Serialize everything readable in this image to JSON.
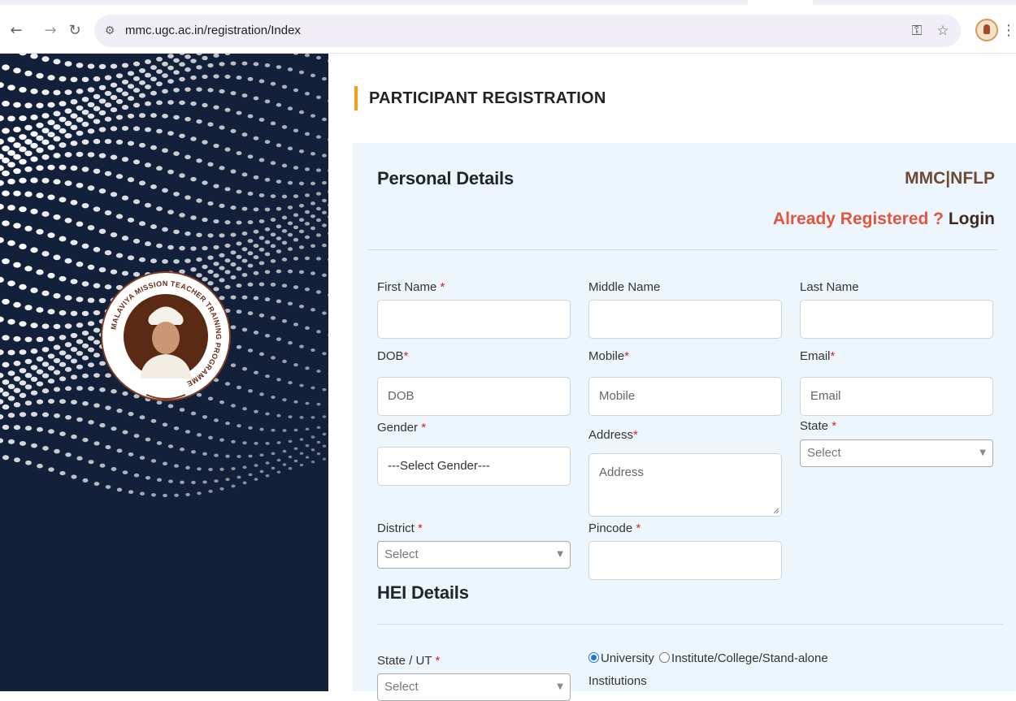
{
  "browser": {
    "url": "mmc.ugc.ac.in/registration/Index",
    "icons": {
      "back": "arrow-left-icon",
      "forward": "arrow-right-icon",
      "reload": "reload-icon",
      "site_info": "site-settings-icon",
      "password": "key-icon",
      "bookmark": "star-icon",
      "menu": "kebab-menu-icon"
    }
  },
  "emblem": {
    "ring_text": "MALAVIYA MISSION TEACHER TRAINING PROGRAMME"
  },
  "page": {
    "title": "PARTICIPANT REGISTRATION",
    "brand": "MMC|NFLP",
    "already_registered": "Already Registered ?",
    "login": "Login"
  },
  "personal": {
    "heading": "Personal Details",
    "first_name": {
      "label": "First Name",
      "value": ""
    },
    "middle_name": {
      "label": "Middle Name",
      "value": ""
    },
    "last_name": {
      "label": "Last Name",
      "value": ""
    },
    "dob": {
      "label": "DOB",
      "placeholder": "DOB"
    },
    "mobile": {
      "label": "Mobile",
      "placeholder": "Mobile"
    },
    "email": {
      "label": "Email",
      "placeholder": "Email"
    },
    "gender": {
      "label": "Gender",
      "selected": "---Select Gender---"
    },
    "address": {
      "label": "Address",
      "placeholder": "Address"
    },
    "state": {
      "label": "State",
      "selected": "Select"
    },
    "district": {
      "label": "District",
      "selected": "Select"
    },
    "pincode": {
      "label": "Pincode",
      "value": ""
    }
  },
  "hei": {
    "heading": "HEI Details",
    "state_ut": {
      "label": "State / UT",
      "selected": "Select"
    },
    "type_options": [
      "University",
      "Institute/College/Stand-alone",
      "Institutions"
    ],
    "selected_type": "University"
  },
  "colors": {
    "accent": "#f6a01a",
    "required": "#d9222a",
    "brand": "#6b4a36",
    "login_question": "#e2553e",
    "panel_bg": "#13203a",
    "card_bg": "#eef6fd"
  }
}
